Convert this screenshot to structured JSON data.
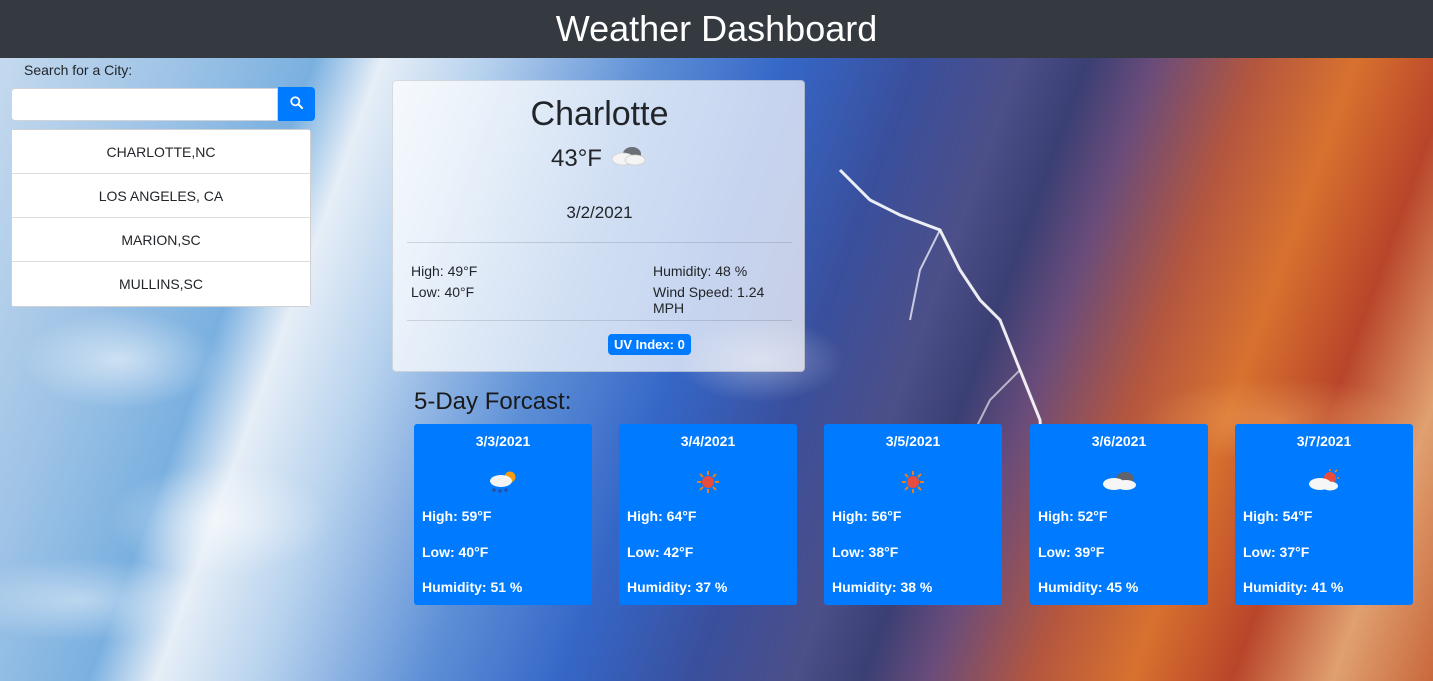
{
  "header": {
    "title": "Weather Dashboard"
  },
  "search": {
    "label": "Search for a City:",
    "value": "",
    "placeholder": "",
    "button_icon": "search-icon"
  },
  "history": [
    {
      "label": "CHARLOTTE,NC"
    },
    {
      "label": "LOS ANGELES, CA"
    },
    {
      "label": "MARION,SC"
    },
    {
      "label": "MULLINS,SC"
    }
  ],
  "current": {
    "city": "Charlotte",
    "temp": "43°F",
    "icon": "cloudy-icon",
    "date": "3/2/2021",
    "high": "High: 49°F",
    "low": "Low: 40°F",
    "humidity": "Humidity: 48 %",
    "wind": "Wind Speed: 1.24 MPH",
    "uv": "UV Index: 0"
  },
  "forecast": {
    "title": "5-Day Forcast:",
    "days": [
      {
        "date": "3/3/2021",
        "icon": "rain-sun-icon",
        "high": "High: 59°F",
        "low": "Low: 40°F",
        "humidity": "Humidity: 51 %"
      },
      {
        "date": "3/4/2021",
        "icon": "sun-icon",
        "high": "High: 64°F",
        "low": "Low: 42°F",
        "humidity": "Humidity: 37 %"
      },
      {
        "date": "3/5/2021",
        "icon": "sun-icon",
        "high": "High: 56°F",
        "low": "Low: 38°F",
        "humidity": "Humidity: 38 %"
      },
      {
        "date": "3/6/2021",
        "icon": "cloudy-icon",
        "high": "High: 52°F",
        "low": "Low: 39°F",
        "humidity": "Humidity: 45 %"
      },
      {
        "date": "3/7/2021",
        "icon": "partly-cloudy-icon",
        "high": "High: 54°F",
        "low": "Low: 37°F",
        "humidity": "Humidity: 41 %"
      }
    ]
  },
  "colors": {
    "primary": "#007bff",
    "header_bg": "#343a40"
  }
}
